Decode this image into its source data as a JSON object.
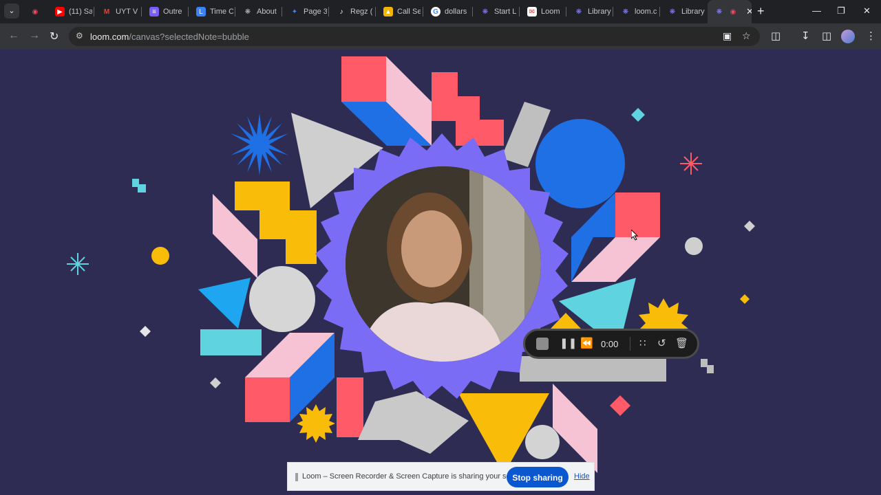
{
  "browser": {
    "tabs": [
      {
        "title": "",
        "icon": "loom-record-icon",
        "color": "#e84a5f"
      },
      {
        "title": "(11) Sa",
        "icon": "youtube-icon",
        "color": "#ff0000"
      },
      {
        "title": "UYT V",
        "icon": "gmail-icon",
        "color": "#ea4335"
      },
      {
        "title": "Outre",
        "icon": "list-icon",
        "color": "#7b5cff"
      },
      {
        "title": "Time C",
        "icon": "clock-icon",
        "color": "#3b82f6"
      },
      {
        "title": "About",
        "icon": "globe-icon",
        "color": "#9aa0a6"
      },
      {
        "title": "Page 3",
        "icon": "page-icon",
        "color": "#4285f4"
      },
      {
        "title": "Regz (",
        "icon": "tiktok-icon",
        "color": "#000000"
      },
      {
        "title": "Call Se",
        "icon": "calendar-icon",
        "color": "#f4b400"
      },
      {
        "title": "dollars",
        "icon": "google-icon",
        "color": "#4285f4"
      },
      {
        "title": "Start L",
        "icon": "loom-icon",
        "color": "#625df5"
      },
      {
        "title": "Loom",
        "icon": "mail-icon",
        "color": "#d93025"
      },
      {
        "title": "Library",
        "icon": "loom-icon",
        "color": "#625df5"
      },
      {
        "title": "loom.c",
        "icon": "loom-icon",
        "color": "#625df5"
      },
      {
        "title": "Library",
        "icon": "loom-icon",
        "color": "#625df5"
      }
    ],
    "active_tab": {
      "title": "",
      "icon": "loom-icon"
    },
    "url_domain": "loom.com",
    "url_path": "/canvas?selectedNote=bubble"
  },
  "recorder": {
    "timer": "0:00"
  },
  "sharebar": {
    "message": "Loom – Screen Recorder & Screen Capture is sharing your screen.",
    "stop_label": "Stop sharing",
    "hide_label": "Hide"
  },
  "colors": {
    "background": "#2e2c52",
    "purple_ring": "#7b6cf6",
    "blue": "#1f6fe5",
    "red": "#ff5a67",
    "pink": "#f6c3d4",
    "yellow": "#f9bd09",
    "cyan": "#5fd3e0"
  }
}
